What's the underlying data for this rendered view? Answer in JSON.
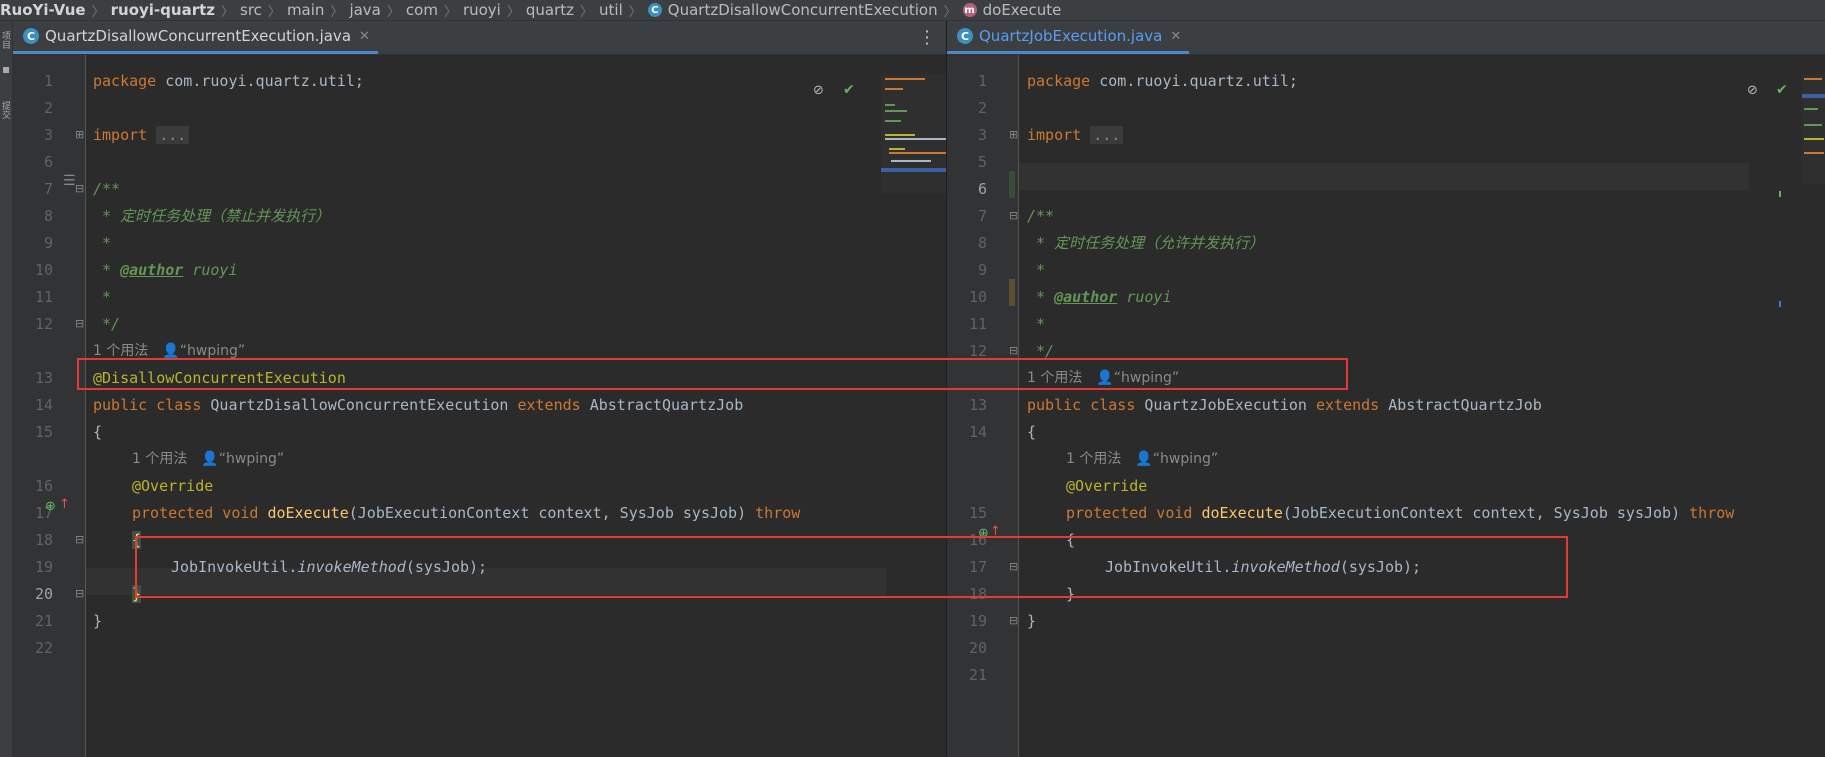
{
  "breadcrumb": {
    "project": "RuoYi-Vue",
    "module": "ruoyi-quartz",
    "path": [
      "src",
      "main",
      "java",
      "com",
      "ruoyi",
      "quartz",
      "util"
    ],
    "class_name": "QuartzDisallowConcurrentExecution",
    "method_name": "doExecute"
  },
  "side_strip": {
    "labels": [
      "项目",
      "提交"
    ]
  },
  "left_editor": {
    "tab_label": "QuartzDisallowConcurrentExecution.java",
    "line_numbers": [
      "1",
      "2",
      "3",
      "6",
      "7",
      "8",
      "9",
      "10",
      "11",
      "12",
      "13",
      "14",
      "15",
      "16",
      "17",
      "18",
      "19",
      "20",
      "21",
      "22"
    ],
    "current_line": "20",
    "code": {
      "l1_kw": "package",
      "l1_rest": " com.ruoyi.quartz.util;",
      "l3_kw": "import",
      "l3_fold": "...",
      "l7": "/**",
      "l8": " * 定时任务处理（禁止并发执行）",
      "l9": " *",
      "l10_pre": " * ",
      "l10_tag": "@author",
      "l10_post": " ruoyi",
      "l11": " *",
      "l12": " */",
      "hint1_usage": "1 个用法",
      "hint1_user": "“hwping”",
      "l13": "@DisallowConcurrentExecution",
      "l14_kw1": "public class",
      "l14_name": " QuartzDisallowConcurrentExecution ",
      "l14_kw2": "extends",
      "l14_rest": " AbstractQuartzJob",
      "l15": "{",
      "hint2_usage": "1 个用法",
      "hint2_user": "“hwping”",
      "l16": "@Override",
      "l17_kw": "protected void",
      "l17_fn": " doExecute",
      "l17_rest": "(JobExecutionContext context, SysJob sysJob) ",
      "l17_throws": "throw",
      "l18": "{",
      "l19_pre": "JobInvokeUtil.",
      "l19_method": "invokeMethod",
      "l19_post": "(sysJob);",
      "l20": "}",
      "l21": "}"
    }
  },
  "right_editor": {
    "tab_label": "QuartzJobExecution.java",
    "line_numbers": [
      "1",
      "2",
      "3",
      "5",
      "6",
      "7",
      "8",
      "9",
      "10",
      "11",
      "12",
      "13",
      "14",
      "15",
      "16",
      "17",
      "18",
      "19",
      "20",
      "21"
    ],
    "code": {
      "l1_kw": "package",
      "l1_rest": " com.ruoyi.quartz.util;",
      "l3_kw": "import",
      "l3_fold": "...",
      "l7": "/**",
      "l8": " * 定时任务处理（允许并发执行）",
      "l9": " *",
      "l10_pre": " * ",
      "l10_tag": "@author",
      "l10_post": " ruoyi",
      "l11": " *",
      "l12": " */",
      "hint1_usage": "1 个用法",
      "hint1_user": "“hwping”",
      "l13_kw1": "public class",
      "l13_name": " QuartzJobExecution ",
      "l13_kw2": "extends",
      "l13_rest": " AbstractQuartzJob",
      "l14": "{",
      "hint2_usage": "1 个用法",
      "hint2_user": "“hwping”",
      "l15": "@Override",
      "l16_kw": "protected void",
      "l16_fn": " doExecute",
      "l16_rest": "(JobExecutionContext context, SysJob sysJob) ",
      "l16_throws": "throw",
      "l17": "{",
      "l18_pre": "JobInvokeUtil.",
      "l18_method": "invokeMethod",
      "l18_post": "(sysJob);",
      "l19": "}",
      "l20": "}"
    }
  },
  "colors": {
    "highlight_box": "#e53935",
    "keyword": "#cc7832",
    "annotation": "#bbb529",
    "comment": "#629755",
    "method": "#ffc66d",
    "tab_underline": "#4a88c7"
  }
}
